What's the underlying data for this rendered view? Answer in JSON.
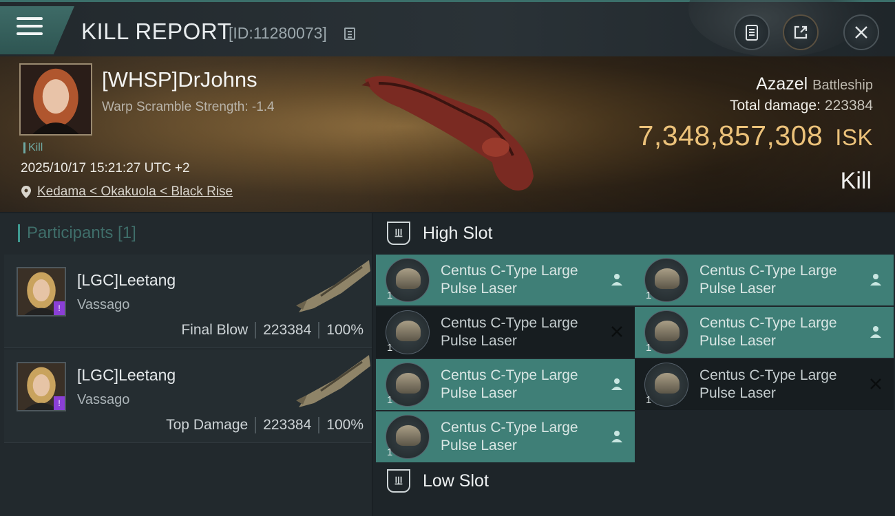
{
  "header": {
    "title": "KILL REPORT",
    "report_id": "[ID:11280073]"
  },
  "victim": {
    "name": "[WHSP]DrJohns",
    "subtitle": "Warp Scramble Strength: -1.4",
    "tag": "Kill",
    "datetime": "2025/10/17 15:21:27 UTC +2",
    "location": "Kedama < Okakuola < Black Rise",
    "ship_name": "Azazel",
    "ship_class": "Battleship",
    "damage_label": "Total damage:",
    "damage_value": "223384",
    "isk_value": "7,348,857,308",
    "isk_unit": "ISK",
    "result": "Kill"
  },
  "participants": {
    "title": "Participants [1]",
    "rows": [
      {
        "name": "[LGC]Leetang",
        "ship": "Vassago",
        "label": "Final Blow",
        "damage": "223384",
        "percent": "100%"
      },
      {
        "name": "[LGC]Leetang",
        "ship": "Vassago",
        "label": "Top Damage",
        "damage": "223384",
        "percent": "100%"
      }
    ]
  },
  "slots": {
    "high": {
      "title": "High Slot",
      "modules": [
        {
          "name": "Centus C-Type Large Pulse Laser",
          "qty": "1",
          "status": "dropped"
        },
        {
          "name": "Centus C-Type Large Pulse Laser",
          "qty": "1",
          "status": "dropped"
        },
        {
          "name": "Centus C-Type Large Pulse Laser",
          "qty": "1",
          "status": "destroyed"
        },
        {
          "name": "Centus C-Type Large Pulse Laser",
          "qty": "1",
          "status": "dropped"
        },
        {
          "name": "Centus C-Type Large Pulse Laser",
          "qty": "1",
          "status": "dropped"
        },
        {
          "name": "Centus C-Type Large Pulse Laser",
          "qty": "1",
          "status": "destroyed"
        },
        {
          "name": "Centus C-Type Large Pulse Laser",
          "qty": "1",
          "status": "dropped"
        }
      ]
    },
    "low": {
      "title": "Low Slot"
    }
  },
  "colors": {
    "accent_teal": "#3f7f77",
    "isk_gold": "#ecc27a",
    "destroyed_row": "#171d20"
  }
}
